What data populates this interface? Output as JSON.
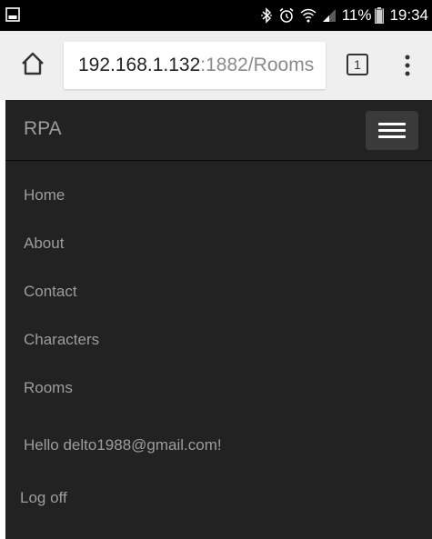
{
  "status_bar": {
    "left_icon": "gallery-icon",
    "icons": [
      "bluetooth-icon",
      "alarm-icon",
      "wifi-icon",
      "signal-icon"
    ],
    "battery": "11%",
    "battery_icon": "battery-icon",
    "time": "19:34"
  },
  "browser": {
    "home_icon": "home-icon",
    "url_host": "192.168.1.132",
    "url_rest": ":1882/Rooms",
    "tab_count": "1",
    "menu_icon": "more-vert-icon"
  },
  "navbar": {
    "brand": "RPA",
    "toggle_icon": "hamburger-icon",
    "items": [
      {
        "label": "Home"
      },
      {
        "label": "About"
      },
      {
        "label": "Contact"
      },
      {
        "label": "Characters"
      },
      {
        "label": "Rooms"
      }
    ],
    "greeting": "Hello delto1988@gmail.com!",
    "logoff": "Log off"
  },
  "colors": {
    "navbar_bg": "#222222",
    "nav_text": "#9d9d9d",
    "toggle_bg": "#3a3a3a",
    "status_bar_bg": "#000000",
    "browser_bar_bg": "#efefef"
  }
}
